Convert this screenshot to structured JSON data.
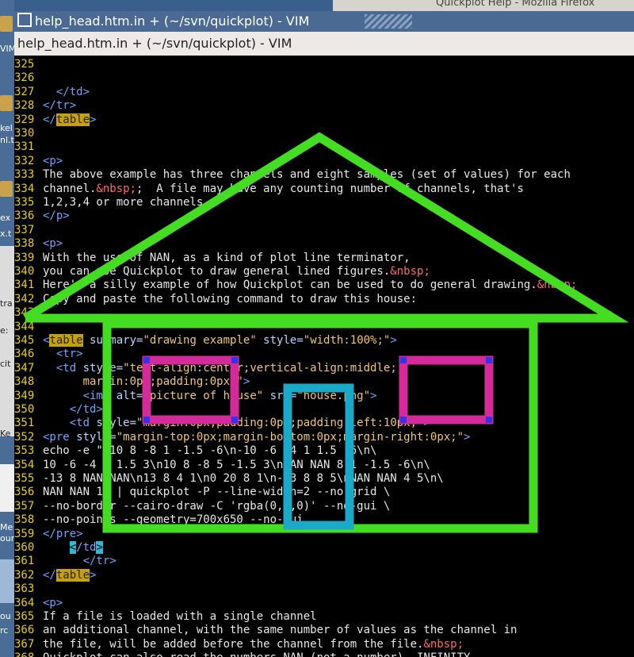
{
  "window": {
    "title": "help_head.htm.in + (~/svn/quickplot) - VIM",
    "menu_title": "help_head.htm.in + (~/svn/quickplot) - VIM"
  },
  "background": {
    "other_window_title": "Quickplot Help - Mozilla Firefox",
    "left_labels": [
      "VIM",
      "kel",
      "nl.t",
      "ex",
      "x.t",
      "tra",
      "e:",
      "cit",
      "Ke",
      "Me",
      "our",
      "ou",
      "rc"
    ]
  },
  "overlay_colors": {
    "house": "#44dd22",
    "windows": "#d42a9a",
    "door": "#1aa9c9",
    "corners": "#3333ee"
  },
  "editor": {
    "lines": [
      {
        "n": "325",
        "segs": []
      },
      {
        "n": "326",
        "segs": []
      },
      {
        "n": "327",
        "segs": [
          [
            "",
            "  "
          ],
          [
            "tag",
            "</td>"
          ]
        ]
      },
      {
        "n": "328",
        "segs": [
          [
            "tag",
            "</tr>"
          ]
        ]
      },
      {
        "n": "329",
        "segs": [
          [
            "tag",
            "</"
          ],
          [
            "srch",
            "table"
          ],
          [
            "tag",
            ">"
          ]
        ]
      },
      {
        "n": "330",
        "segs": []
      },
      {
        "n": "331",
        "segs": []
      },
      {
        "n": "332",
        "segs": [
          [
            "tag",
            "<p>"
          ]
        ]
      },
      {
        "n": "333",
        "segs": [
          [
            "",
            "The above example has three channels and eight samples (set of values) for each"
          ]
        ]
      },
      {
        "n": "334",
        "segs": [
          [
            "",
            "channel."
          ],
          [
            "ent",
            "&nbsp;"
          ],
          [
            "",
            ";  A file may have any counting number of channels, that's"
          ]
        ]
      },
      {
        "n": "335",
        "segs": [
          [
            "",
            "1,2,3,4 or more channels."
          ]
        ]
      },
      {
        "n": "336",
        "segs": [
          [
            "tag",
            "</p>"
          ]
        ]
      },
      {
        "n": "337",
        "segs": []
      },
      {
        "n": "338",
        "segs": [
          [
            "tag",
            "<p>"
          ]
        ]
      },
      {
        "n": "339",
        "segs": [
          [
            "",
            "With the use of NAN, as a kind of plot line terminator,"
          ]
        ]
      },
      {
        "n": "340",
        "segs": [
          [
            "",
            "you can use Quickplot to draw general lined figures."
          ],
          [
            "ent",
            "&nbsp;"
          ]
        ]
      },
      {
        "n": "341",
        "segs": [
          [
            "",
            "Here's a silly example of how Quickplot can be used to do general drawing."
          ],
          [
            "ent",
            "&nbsp;"
          ]
        ]
      },
      {
        "n": "342",
        "segs": [
          [
            "",
            "Copy and paste the following command to draw this house:"
          ]
        ]
      },
      {
        "n": "343",
        "segs": []
      },
      {
        "n": "344",
        "segs": []
      },
      {
        "n": "345",
        "segs": [
          [
            "tag",
            "<"
          ],
          [
            "srch",
            "table"
          ],
          [
            "attr",
            " summary="
          ],
          [
            "str",
            "\"drawing example\""
          ],
          [
            "attr",
            " style="
          ],
          [
            "str",
            "\"width:100%;\""
          ],
          [
            "tag",
            ">"
          ]
        ]
      },
      {
        "n": "346",
        "segs": [
          [
            "",
            "  "
          ],
          [
            "tag",
            "<tr>"
          ]
        ]
      },
      {
        "n": "347",
        "segs": [
          [
            "",
            "  "
          ],
          [
            "tag",
            "<td"
          ],
          [
            "attr",
            " style="
          ],
          [
            "str",
            "\"text-align:center;vertical-align:middle;"
          ]
        ]
      },
      {
        "n": "348",
        "segs": [
          [
            "str",
            "      margin:0px;padding:0px;\""
          ],
          [
            "tag",
            ">"
          ]
        ]
      },
      {
        "n": "349",
        "segs": [
          [
            "",
            "      "
          ],
          [
            "tag",
            "<img"
          ],
          [
            "attr",
            " alt="
          ],
          [
            "str",
            "\"picture of house\""
          ],
          [
            "attr",
            " src="
          ],
          [
            "str",
            "\"house.png\""
          ],
          [
            "tag",
            ">"
          ]
        ]
      },
      {
        "n": "350",
        "segs": [
          [
            "",
            "    "
          ],
          [
            "tag",
            "</td>"
          ]
        ]
      },
      {
        "n": "351",
        "segs": [
          [
            "",
            "    "
          ],
          [
            "tag",
            "<td"
          ],
          [
            "attr",
            " style="
          ],
          [
            "str",
            "\"margin:0px;padding:0px;padding-left:10px;\""
          ],
          [
            "tag",
            ">"
          ]
        ]
      },
      {
        "n": "352",
        "segs": [
          [
            "tag",
            "<pre"
          ],
          [
            "attr",
            " style="
          ],
          [
            "str",
            "\"margin-top:0px;margin-bottom:0px;margin-right:0px;\""
          ],
          [
            "tag",
            ">"
          ]
        ]
      },
      {
        "n": "353",
        "segs": [
          [
            "",
            "echo -e \"-10 8 -8 1 -1.5 -6\\n-10 -6 -4 1 1.5 -6\\n\\"
          ]
        ]
      },
      {
        "n": "354",
        "segs": [
          [
            "",
            "10 -6 -4 1 1.5 3\\n10 8 -8 5 -1.5 3\\nNAN NAN 8 1 -1.5 -6\\n\\"
          ]
        ]
      },
      {
        "n": "355",
        "segs": [
          [
            "",
            "-13 8 NAN NAN\\n13 8 4 1\\n0 20 8 1\\n-13 8 8 5\\nNAN NAN 4 5\\n\\"
          ]
        ]
      },
      {
        "n": "356",
        "segs": [
          [
            "",
            "NAN NAN 1\" | quickplot -P --line-width=2 --no-grid \\"
          ]
        ]
      },
      {
        "n": "357",
        "segs": [
          [
            "",
            "--no-border --cairo-draw -C 'rgba(0,0,0)' --no-gui \\"
          ]
        ]
      },
      {
        "n": "358",
        "segs": [
          [
            "",
            "--no-points --geometry=700x650 --no-gui"
          ]
        ]
      },
      {
        "n": "359",
        "segs": [
          [
            "tag",
            "</pre>"
          ]
        ]
      },
      {
        "n": "360",
        "segs": [
          [
            "",
            "    "
          ],
          [
            "cur",
            "<"
          ],
          [
            "tag",
            "/td"
          ],
          [
            "cur",
            ">"
          ]
        ]
      },
      {
        "n": "361",
        "segs": [
          [
            "",
            "      "
          ],
          [
            "tag",
            "</tr>"
          ]
        ]
      },
      {
        "n": "362",
        "segs": [
          [
            "tag",
            "</"
          ],
          [
            "srch",
            "table"
          ],
          [
            "tag",
            ">"
          ]
        ]
      },
      {
        "n": "363",
        "segs": []
      },
      {
        "n": "364",
        "segs": [
          [
            "tag",
            "<p>"
          ]
        ]
      },
      {
        "n": "365",
        "segs": [
          [
            "",
            "If a file is loaded with a single channel"
          ]
        ]
      },
      {
        "n": "366",
        "segs": [
          [
            "",
            "an additional channel, with the same number of values as the channel in"
          ]
        ]
      },
      {
        "n": "367",
        "segs": [
          [
            "",
            "the file, will be added before the channel from the file."
          ],
          [
            "ent",
            "&nbsp;"
          ]
        ]
      },
      {
        "n": "368",
        "segs": [
          [
            "",
            "Quickplot can also read the numbers NAN (not a number), INFINITY"
          ]
        ]
      }
    ]
  }
}
